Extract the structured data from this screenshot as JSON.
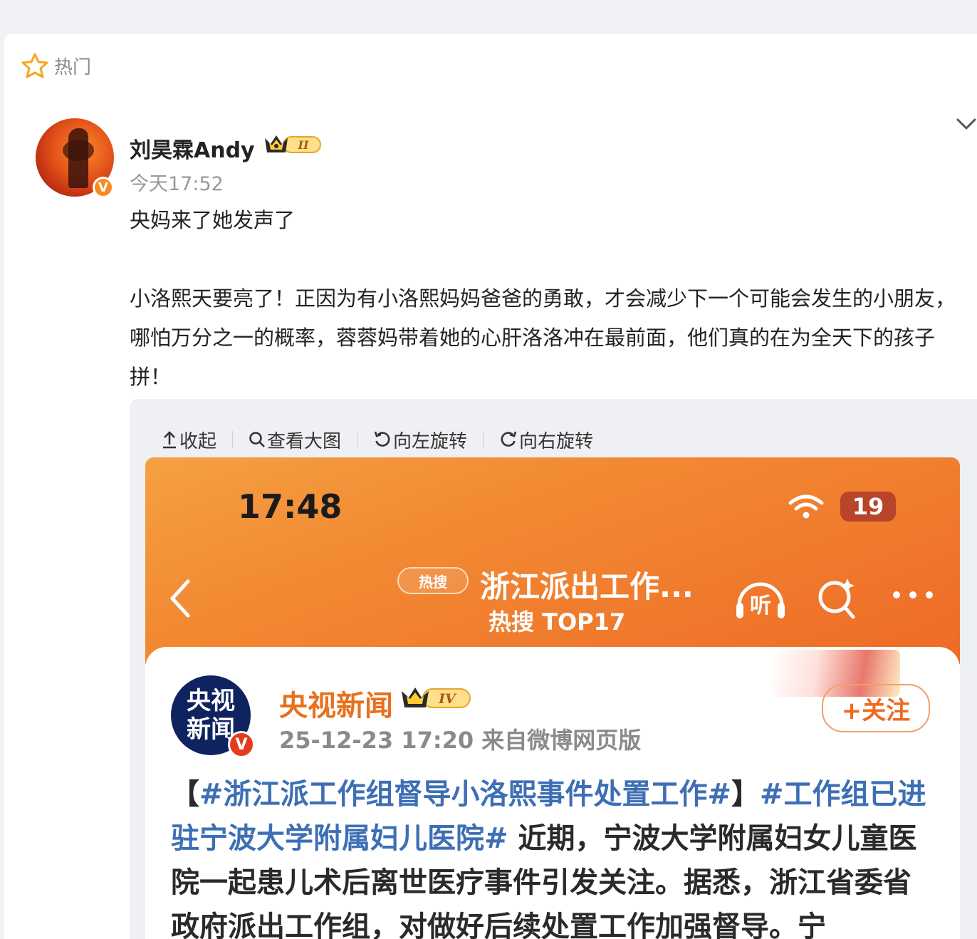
{
  "feed": {
    "section_label": "热门"
  },
  "post": {
    "username": "刘昊霖Andy",
    "member_level": "II",
    "time": "今天17:52",
    "verified_mark": "V",
    "text_line1": "央妈来了她发声了",
    "text_line2": "小洛熙天要亮了！正因为有小洛熙妈妈爸爸的勇敢，才会减少下一个可能会发生的小朋友，哪怕万分之一的概率，蓉蓉妈带着她的心肝洛洛冲在最前面，他们真的在为全天下的孩子拼！"
  },
  "image_toolbar": {
    "collapse": "收起",
    "view_large": "查看大图",
    "rotate_left": "向左旋转",
    "rotate_right": "向右旋转"
  },
  "embedded_screenshot": {
    "status_time": "17:48",
    "battery": "19",
    "hot_search_pill": "热搜",
    "nav_title": "浙江派出工作...",
    "nav_subtitle": "热搜 TOP17",
    "listen_label": "听",
    "account_name": "央视新闻",
    "account_level": "IV",
    "avatar_text_top": "央视",
    "avatar_text_bottom": "新闻",
    "meta": "25-12-23 17:20  来自微博网页版",
    "follow_button": "+关注",
    "news_open": "【",
    "news_tag1": "#浙江派工作组督导小洛熙事件处置工作#",
    "news_close": "】",
    "news_tag2": "#工作组已进驻宁波大学附属妇儿医院#",
    "news_body": " 近期，宁波大学附属妇女儿童医院一起患儿术后离世医疗事件引发关注。据悉，浙江省委省政府派出工作组，对做好后续处置工作加强督导。宁"
  },
  "colors": {
    "orange_accent": "#f78b1f",
    "topic_blue": "#3d6fb5",
    "weibo_orange": "#e8701d"
  },
  "icons": [
    "star-outline-icon",
    "crown-icon",
    "chevron-down-icon",
    "upload-arrow-icon",
    "magnifier-icon",
    "rotate-left-icon",
    "rotate-right-icon",
    "wifi-icon",
    "back-arrow-icon",
    "headphones-icon",
    "search-sparkle-icon",
    "more-dots-icon"
  ]
}
